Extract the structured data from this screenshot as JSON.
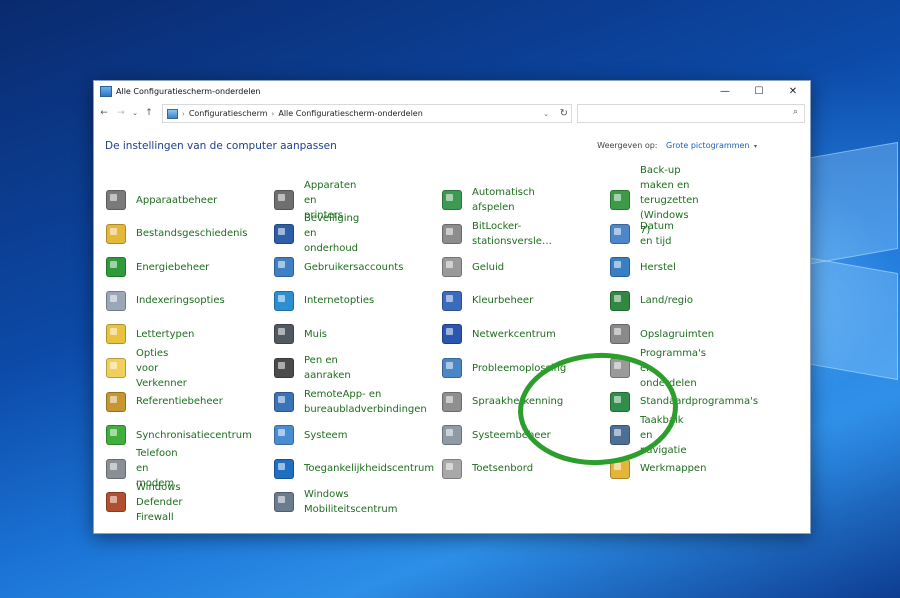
{
  "window": {
    "title": "Alle Configuratiescherm-onderdelen",
    "buttons": {
      "minimize": "—",
      "maximize": "☐",
      "close": "✕"
    }
  },
  "addressbar": {
    "back": "←",
    "forward": "→",
    "dropdown": "⌄",
    "up": "↑",
    "crumbs": [
      "Configuratiescherm",
      "Alle Configuratiescherm-onderdelen"
    ],
    "separator": "›",
    "dropdown_chevron": "⌄",
    "refresh": "↻",
    "search_placeholder": "",
    "search_icon": "⌕"
  },
  "content": {
    "headline": "De instellingen van de computer aanpassen",
    "viewby_label": "Weergeven op:",
    "viewby_value": "Grote pictogrammen",
    "viewby_arrow": "▾"
  },
  "columns": [
    [
      {
        "label": "Apparaatbeheer",
        "icon": "device-manager-icon",
        "color": "#7a7a7a"
      },
      {
        "label": "Bestandsgeschiedenis",
        "icon": "file-history-icon",
        "color": "#e5b83b"
      },
      {
        "label": "Energiebeheer",
        "icon": "power-options-icon",
        "color": "#2f9a3a"
      },
      {
        "label": "Indexeringsopties",
        "icon": "indexing-icon",
        "color": "#9aa7b6"
      },
      {
        "label": "Lettertypen",
        "icon": "fonts-icon",
        "color": "#e9c23f"
      },
      {
        "label": "Opties voor Verkenner",
        "icon": "explorer-options-icon",
        "color": "#f2cf5a"
      },
      {
        "label": "Referentiebeheer",
        "icon": "credential-manager-icon",
        "color": "#c8962e"
      },
      {
        "label": "Synchronisatiecentrum",
        "icon": "sync-center-icon",
        "color": "#3fae3a"
      },
      {
        "label": "Telefoon en modem",
        "icon": "phone-modem-icon",
        "color": "#8a8f96"
      },
      {
        "label": "Windows Defender\nFirewall",
        "icon": "firewall-icon",
        "color": "#b0502f"
      }
    ],
    [
      {
        "label": "Apparaten en printers",
        "icon": "devices-printers-icon",
        "color": "#6f6f6f"
      },
      {
        "label": "Beveiliging en onderhoud",
        "icon": "security-maintenance-icon",
        "color": "#2c5fa8"
      },
      {
        "label": "Gebruikersaccounts",
        "icon": "user-accounts-icon",
        "color": "#3f7fc3"
      },
      {
        "label": "Internetopties",
        "icon": "internet-options-icon",
        "color": "#2b8fd0"
      },
      {
        "label": "Muis",
        "icon": "mouse-icon",
        "color": "#505860"
      },
      {
        "label": "Pen en aanraken",
        "icon": "pen-touch-icon",
        "color": "#4b4b4b"
      },
      {
        "label": "RemoteApp- en\nbureaubladverbindingen",
        "icon": "remoteapp-icon",
        "color": "#3b73b8"
      },
      {
        "label": "Systeem",
        "icon": "system-icon",
        "color": "#4a8cd0"
      },
      {
        "label": "Toegankelijkheidscentrum",
        "icon": "ease-of-access-icon",
        "color": "#1f6ec0"
      },
      {
        "label": "Windows\nMobiliteitscentrum",
        "icon": "mobility-center-icon",
        "color": "#6b7c8f"
      }
    ],
    [
      {
        "label": "Automatisch afspelen",
        "icon": "autoplay-icon",
        "color": "#3c9b50"
      },
      {
        "label": "BitLocker-stationsversle…",
        "icon": "bitlocker-icon",
        "color": "#8d8d8d"
      },
      {
        "label": "Geluid",
        "icon": "sound-icon",
        "color": "#9a9a9a"
      },
      {
        "label": "Kleurbeheer",
        "icon": "color-management-icon",
        "color": "#3a6bbd"
      },
      {
        "label": "Netwerkcentrum",
        "icon": "network-center-icon",
        "color": "#2a55b0"
      },
      {
        "label": "Probleemoplossing",
        "icon": "troubleshooting-icon",
        "color": "#4b86c6"
      },
      {
        "label": "Spraakherkenning",
        "icon": "speech-recognition-icon",
        "color": "#8f8f8f"
      },
      {
        "label": "Systeembeheer",
        "icon": "admin-tools-icon",
        "color": "#8e9aa6"
      },
      {
        "label": "Toetsenbord",
        "icon": "keyboard-icon",
        "color": "#a8a8a8"
      }
    ],
    [
      {
        "label": "Back-up maken en\nterugzetten (Windows 7)",
        "icon": "backup-restore-icon",
        "color": "#3d9a47"
      },
      {
        "label": "Datum en tijd",
        "icon": "date-time-icon",
        "color": "#4c88c9"
      },
      {
        "label": "Herstel",
        "icon": "recovery-icon",
        "color": "#3a7ec4"
      },
      {
        "label": "Land/regio",
        "icon": "region-icon",
        "color": "#2f8a3f"
      },
      {
        "label": "Opslagruimten",
        "icon": "storage-spaces-icon",
        "color": "#8a8a8a"
      },
      {
        "label": "Programma's en\nonderdelen",
        "icon": "programs-features-icon",
        "color": "#9a9a9a"
      },
      {
        "label": "Standaardprogramma's",
        "icon": "default-programs-icon",
        "color": "#2f8f4a"
      },
      {
        "label": "Taakbalk en navigatie",
        "icon": "taskbar-navigation-icon",
        "color": "#4c6f96"
      },
      {
        "label": "Werkmappen",
        "icon": "work-folders-icon",
        "color": "#e3b53a"
      }
    ]
  ]
}
